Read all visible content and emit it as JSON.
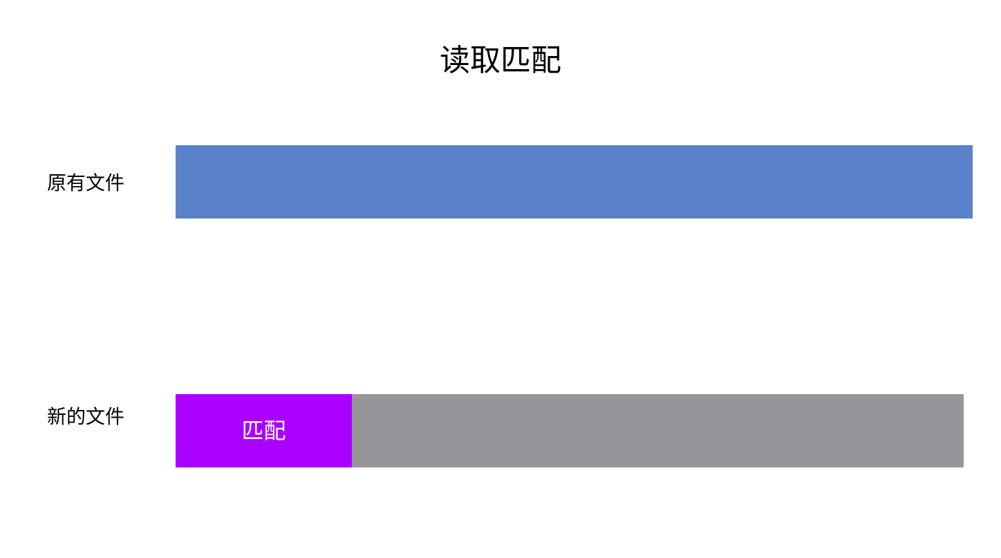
{
  "title": "读取匹配",
  "rows": {
    "original": {
      "label": "原有文件",
      "bar_color": "#5b81cb"
    },
    "new": {
      "label": "新的文件",
      "match_text": "匹配",
      "match_color": "#aa00ff",
      "rest_color": "#969599"
    }
  }
}
